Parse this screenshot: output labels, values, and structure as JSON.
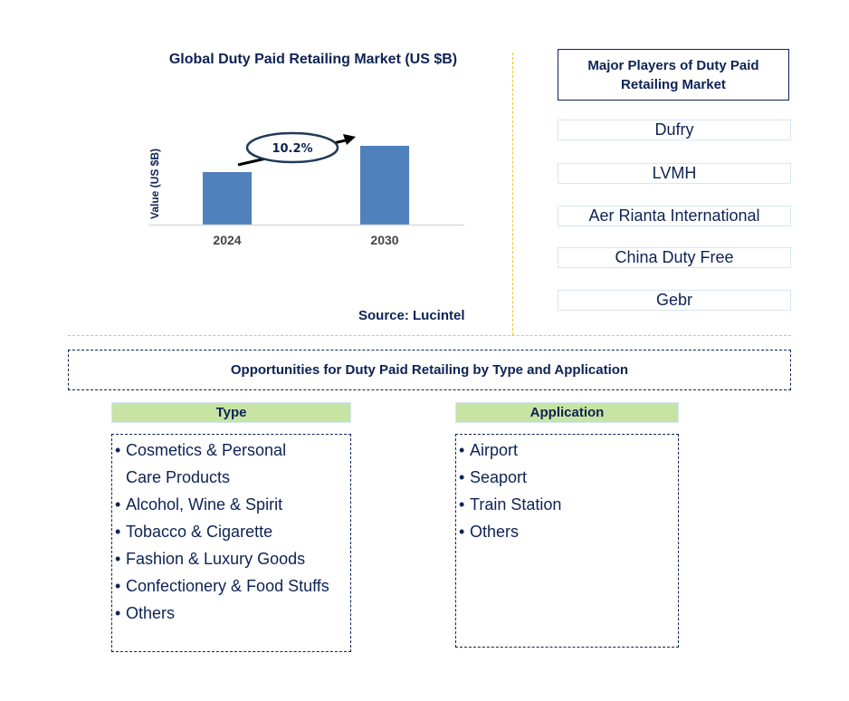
{
  "chart_data": {
    "type": "bar",
    "title": "Global Duty Paid Retailing Market (US $B)",
    "xlabel": "",
    "ylabel": "Value (US $B)",
    "categories": [
      "2024",
      "2030"
    ],
    "values": [
      1.0,
      1.5
    ],
    "value_note": "Relative bar heights; no y-axis ticks shown",
    "annotation": {
      "text": "10.2%",
      "meaning": "CAGR 2024-2030",
      "shape": "ellipse-with-arrow"
    },
    "grid": false,
    "bar_color": "#4f81bd",
    "source": "Source: Lucintel"
  },
  "players": {
    "title": "Major Players of Duty Paid Retailing Market",
    "title_line1": "Major Players of Duty Paid",
    "title_line2": "Retailing Market",
    "items": [
      "Dufry",
      "LVMH",
      "Aer Rianta International",
      "China Duty Free",
      "Gebr"
    ]
  },
  "opportunities": {
    "title": "Opportunities for Duty Paid Retailing by Type and Application",
    "type": {
      "header": "Type",
      "items": [
        "Cosmetics & Personal",
        "Care Products",
        "Alcohol, Wine & Spirit",
        "Tobacco & Cigarette",
        "Fashion & Luxury Goods",
        "Confectionery & Food Stuffs",
        "Others"
      ]
    },
    "application": {
      "header": "Application",
      "items": [
        "Airport",
        "Seaport",
        "Train Station",
        "Others"
      ]
    }
  },
  "colors": {
    "text": "#0d2255",
    "bar": "#4f81bd",
    "divider": "#f5c231",
    "header_green": "#c8e4a4",
    "player_border": "#d4e6f4"
  }
}
